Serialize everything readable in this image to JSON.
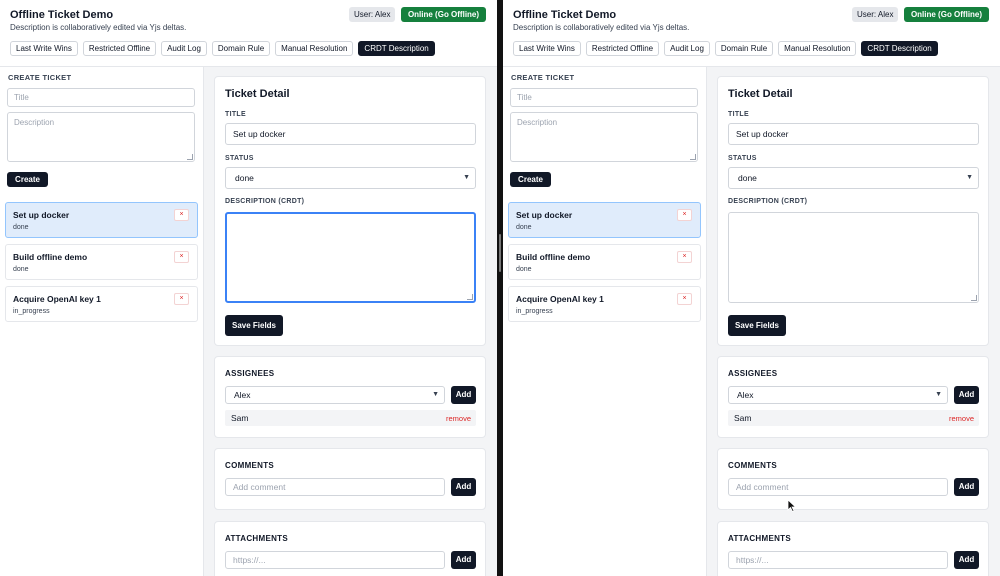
{
  "app": {
    "title": "Offline Ticket Demo",
    "subtitle": "Description is collaboratively edited via Yjs deltas.",
    "user_badge": "User: Alex",
    "online_button": "Online (Go Offline)",
    "online_color": "#15803d",
    "tabs": [
      {
        "label": "Last Write Wins",
        "active": false
      },
      {
        "label": "Restricted Offline",
        "active": false
      },
      {
        "label": "Audit Log",
        "active": false
      },
      {
        "label": "Domain Rule",
        "active": false
      },
      {
        "label": "Manual Resolution",
        "active": false
      },
      {
        "label": "CRDT Description",
        "active": true
      }
    ]
  },
  "sidebar": {
    "create_label": "CREATE TICKET",
    "title_placeholder": "Title",
    "description_placeholder": "Description",
    "create_button": "Create",
    "remove_glyph": "×",
    "tickets": [
      {
        "title": "Set up docker",
        "status": "done",
        "selected": true
      },
      {
        "title": "Build offline demo",
        "status": "done",
        "selected": false
      },
      {
        "title": "Acquire OpenAI key 1",
        "status": "in_progress",
        "selected": false
      }
    ]
  },
  "detail": {
    "heading": "Ticket Detail",
    "title_label": "TITLE",
    "title_value": "Set up docker",
    "status_label": "STATUS",
    "status_value": "done",
    "description_label": "DESCRIPTION (CRDT)",
    "description_value": "",
    "save_button": "Save Fields"
  },
  "assignees": {
    "label": "ASSIGNEES",
    "selected": "Alex",
    "add_button": "Add",
    "list": [
      {
        "name": "Sam",
        "remove": "remove"
      }
    ]
  },
  "comments": {
    "label": "COMMENTS",
    "placeholder": "Add comment",
    "add_button": "Add"
  },
  "attachments": {
    "label": "ATTACHMENTS",
    "placeholder": "https://...",
    "add_button": "Add"
  },
  "icons": {
    "chevron": "chevron-down-icon",
    "cursor": "mouse-pointer-icon"
  },
  "colors": {
    "accent_dark": "#111827",
    "selected_ticket_bg": "#e0ecfb",
    "focus_ring": "#3b82f6",
    "danger": "#dc2626"
  }
}
